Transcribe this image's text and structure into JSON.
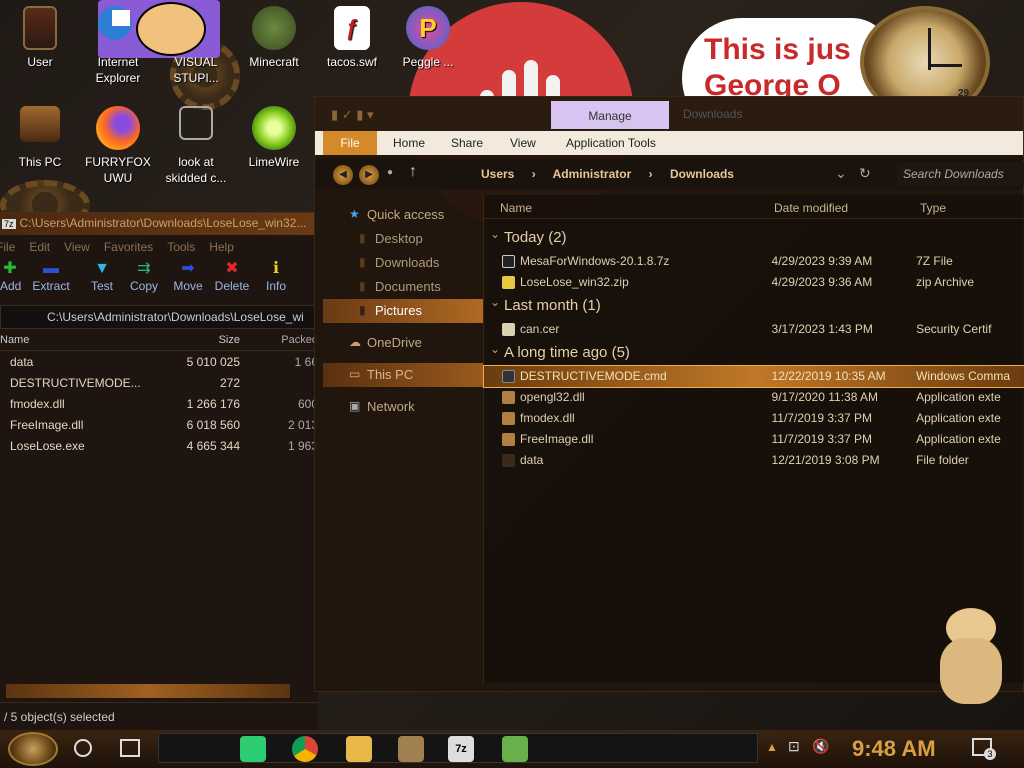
{
  "desktop": {
    "icons": [
      {
        "label": "User",
        "icon": "user-folder-icon"
      },
      {
        "label": "Internet Explorer",
        "icon": "internet-explorer-icon"
      },
      {
        "label": "VISUAL STUPI...",
        "icon": "visual-studio-icon"
      },
      {
        "label": "Minecraft",
        "icon": "minecraft-icon"
      },
      {
        "label": "tacos.swf",
        "icon": "flash-file-icon"
      },
      {
        "label": "Peggle ...",
        "icon": "peggle-icon"
      },
      {
        "label": "This PC",
        "icon": "this-pc-icon"
      },
      {
        "label": "FURRYFOX UWU",
        "icon": "firefox-icon"
      },
      {
        "label": "look at skidded c...",
        "icon": "shortcut-copy-icon"
      },
      {
        "label": "LimeWire",
        "icon": "limewire-icon"
      }
    ],
    "wallpaper_text": "This is just George O... 1984",
    "wallpaper_text_lines": [
      "This is jus",
      "George O"
    ],
    "clock_widget_number": "29"
  },
  "zip_window": {
    "title": "C:\\Users\\Administrator\\Downloads\\LoseLose_win32...",
    "menu": [
      "File",
      "Edit",
      "View",
      "Favorites",
      "Tools",
      "Help"
    ],
    "toolbar": [
      {
        "label": "Add",
        "icon": "plus-icon",
        "color": "#22c03a"
      },
      {
        "label": "Extract",
        "icon": "minus-icon",
        "color": "#2a4fd8"
      },
      {
        "label": "Test",
        "icon": "check-icon",
        "color": "#2ab8e0"
      },
      {
        "label": "Copy",
        "icon": "double-arrow-icon",
        "color": "#2ab870"
      },
      {
        "label": "Move",
        "icon": "arrow-right-icon",
        "color": "#2a4fd8"
      },
      {
        "label": "Delete",
        "icon": "x-icon",
        "color": "#e02a2a"
      },
      {
        "label": "Info",
        "icon": "info-icon",
        "color": "#e8d020"
      }
    ],
    "path": "C:\\Users\\Administrator\\Downloads\\LoseLose_wi",
    "columns": [
      "Name",
      "Size",
      "Packed"
    ],
    "rows": [
      {
        "name": "data",
        "size": "5 010 025",
        "packed": "1 66"
      },
      {
        "name": "DESTRUCTIVEMODE...",
        "size": "272",
        "packed": ""
      },
      {
        "name": "fmodex.dll",
        "size": "1 266 176",
        "packed": "600"
      },
      {
        "name": "FreeImage.dll",
        "size": "6 018 560",
        "packed": "2 013"
      },
      {
        "name": "LoseLose.exe",
        "size": "4 665 344",
        "packed": "1 963"
      }
    ],
    "status": "/ 5 object(s) selected"
  },
  "explorer": {
    "title": "Downloads",
    "ribbon_context": "Manage",
    "tabs": [
      "File",
      "Home",
      "Share",
      "View",
      "Application Tools"
    ],
    "breadcrumbs": [
      "Users",
      "Administrator",
      "Downloads"
    ],
    "search_placeholder": "Search Downloads",
    "nav": [
      {
        "label": "Quick access",
        "level": 0,
        "icon": "star-icon"
      },
      {
        "label": "Desktop",
        "level": 1,
        "icon": "desktop-folder-icon"
      },
      {
        "label": "Downloads",
        "level": 1,
        "icon": "downloads-folder-icon"
      },
      {
        "label": "Documents",
        "level": 1,
        "icon": "documents-folder-icon"
      },
      {
        "label": "Pictures",
        "level": 1,
        "icon": "pictures-folder-icon"
      },
      {
        "label": "OneDrive",
        "level": 0,
        "icon": "cloud-icon"
      },
      {
        "label": "This PC",
        "level": 0,
        "icon": "computer-icon"
      },
      {
        "label": "Network",
        "level": 0,
        "icon": "network-icon"
      }
    ],
    "columns": [
      "Name",
      "Date modified",
      "Type"
    ],
    "groups": [
      {
        "title": "Today (2)",
        "files": [
          {
            "name": "MesaForWindows-20.1.8.7z",
            "date": "4/29/2023 9:39 AM",
            "type": "7Z File",
            "color": "#222"
          },
          {
            "name": "LoseLose_win32.zip",
            "date": "4/29/2023 9:36 AM",
            "type": "zip Archive",
            "color": "#e8c840"
          }
        ]
      },
      {
        "title": "Last month (1)",
        "files": [
          {
            "name": "can.cer",
            "date": "3/17/2023 1:43 PM",
            "type": "Security Certif",
            "color": "#d8d0b0"
          }
        ]
      },
      {
        "title": "A long time ago (5)",
        "files": [
          {
            "name": "DESTRUCTIVEMODE.cmd",
            "date": "12/22/2019 10:35 AM",
            "type": "Windows Comma",
            "color": "#333"
          },
          {
            "name": "opengl32.dll",
            "date": "9/17/2020 11:38 AM",
            "type": "Application exte",
            "color": "#b08040"
          },
          {
            "name": "fmodex.dll",
            "date": "11/7/2019 3:37 PM",
            "type": "Application exte",
            "color": "#b08040"
          },
          {
            "name": "FreeImage.dll",
            "date": "11/7/2019 3:37 PM",
            "type": "Application exte",
            "color": "#b08040"
          },
          {
            "name": "data",
            "date": "12/21/2019 3:08 PM",
            "type": "File folder",
            "color": "#3a2a1a"
          }
        ]
      }
    ]
  },
  "taskbar": {
    "time": "9:48 AM",
    "notification_count": "3",
    "pinned": [
      "cortana-icon",
      "task-view-icon",
      "messages-icon",
      "chrome-icon",
      "file-explorer-icon",
      "app-icon",
      "7zip-icon",
      "task-manager-icon"
    ]
  }
}
